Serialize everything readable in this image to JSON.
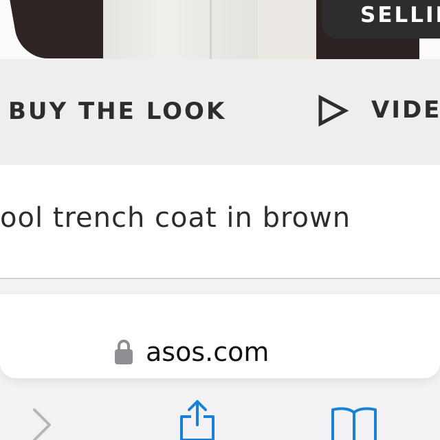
{
  "product": {
    "badge_label": "SELLIN"
  },
  "actions": {
    "buy_the_look_label": "BUY THE LOOK",
    "video_label": "VIDEO",
    "play_icon": "play-icon"
  },
  "product_title": "ool trench coat in brown",
  "browser": {
    "url": "asos.com",
    "lock_icon": "lock-icon",
    "toolbar": {
      "forward_icon": "chevron-right-icon",
      "share_icon": "share-icon",
      "bookmarks_icon": "book-icon"
    },
    "accent_color": "#1a7fd9",
    "disabled_color": "#b6b6b9"
  }
}
